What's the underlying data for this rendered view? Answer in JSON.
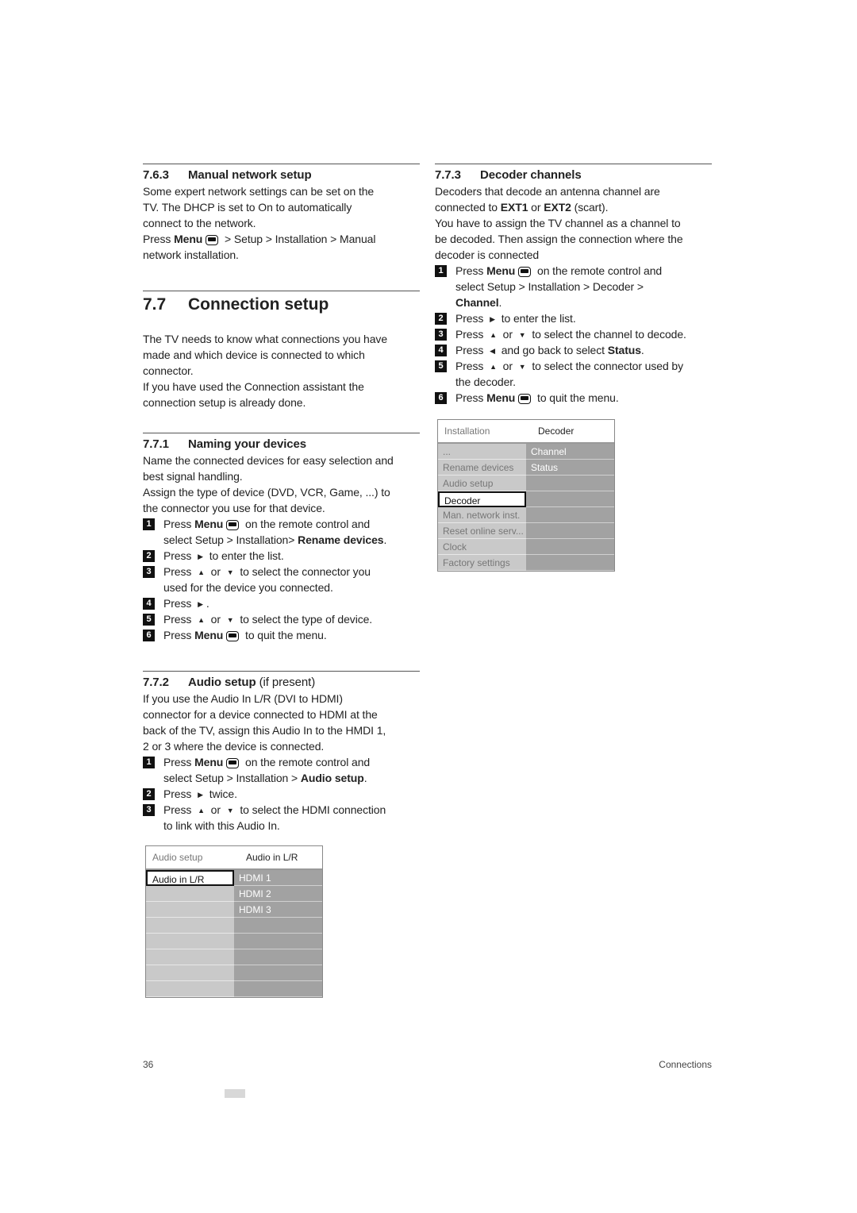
{
  "left": [
    {
      "type": "h3",
      "num": "7.6.3",
      "title": "Manual network setup",
      "lines": [
        [
          "Some expert network settings can be set on the"
        ],
        [
          "TV. The DHCP is set to On to automatically"
        ],
        [
          "connect to the network."
        ],
        [
          "Press ",
          {
            "b": "Menu"
          },
          {
            "icon": "menu"
          },
          " > Setup > Installation > Manual"
        ],
        [
          "network installation."
        ]
      ]
    },
    {
      "type": "h2",
      "num": "7.7",
      "title": "Connection setup",
      "lines": [
        [
          "The TV needs to know what connections you have"
        ],
        [
          "made and which device is connected to which"
        ],
        [
          "connector."
        ],
        [
          "If you have used the Connection assistant the"
        ],
        [
          "connection setup is already done."
        ]
      ]
    },
    {
      "type": "h3",
      "num": "7.7.1",
      "title": "Naming your devices",
      "lines": [
        [
          "Name the connected devices for easy selection and"
        ],
        [
          "best signal handling."
        ],
        [
          "Assign the type of device (DVD, VCR, Game, ...) to"
        ],
        [
          "the connector you use for that device."
        ]
      ],
      "steps": [
        {
          "n": "1",
          "lines": [
            [
              "Press ",
              {
                "b": "Menu"
              },
              {
                "icon": "menu"
              },
              " on the remote control and"
            ],
            [
              "select Setup > Installation> ",
              {
                "b": "Rename devices"
              },
              "."
            ]
          ]
        },
        {
          "n": "2",
          "lines": [
            [
              "Press ",
              {
                "icon": "right"
              },
              " to enter the list."
            ]
          ]
        },
        {
          "n": "3",
          "lines": [
            [
              "Press ",
              {
                "icon": "up"
              },
              " or ",
              {
                "icon": "down"
              },
              " to select the connector you"
            ],
            [
              "used for the device you connected."
            ]
          ]
        },
        {
          "n": "4",
          "lines": [
            [
              "Press ",
              {
                "icon": "right"
              },
              "."
            ]
          ]
        },
        {
          "n": "5",
          "lines": [
            [
              "Press ",
              {
                "icon": "up"
              },
              " or ",
              {
                "icon": "down"
              },
              " to select the type of device."
            ]
          ]
        },
        {
          "n": "6",
          "lines": [
            [
              "Press ",
              {
                "b": "Menu"
              },
              {
                "icon": "menu"
              },
              " to quit the menu."
            ]
          ]
        }
      ]
    },
    {
      "type": "h3",
      "num": "7.7.2",
      "title": "Audio setup",
      "suffix": " (if present)",
      "lines": [
        [
          "If you use the Audio In L/R (DVI to HDMI)"
        ],
        [
          "connector for a device connected to HDMI at the"
        ],
        [
          "back of the TV, assign this Audio In to the HMDI 1,"
        ],
        [
          "2 or 3 where the device is connected."
        ]
      ],
      "steps": [
        {
          "n": "1",
          "lines": [
            [
              "Press ",
              {
                "b": "Menu"
              },
              {
                "icon": "menu"
              },
              " on the remote control and"
            ],
            [
              "select Setup > Installation > ",
              {
                "b": "Audio setup"
              },
              "."
            ]
          ]
        },
        {
          "n": "2",
          "lines": [
            [
              "Press ",
              {
                "icon": "right"
              },
              " twice."
            ]
          ]
        },
        {
          "n": "3",
          "lines": [
            [
              "Press ",
              {
                "icon": "up"
              },
              " or ",
              {
                "icon": "down"
              },
              " to select the HDMI connection"
            ],
            [
              "to link with this Audio In."
            ]
          ]
        }
      ]
    }
  ],
  "right": [
    {
      "type": "h3",
      "num": "7.7.3",
      "title": "Decoder channels",
      "lines": [
        [
          "Decoders that decode an antenna channel are"
        ],
        [
          "connected to ",
          {
            "b": "EXT1"
          },
          " or ",
          {
            "b": "EXT2"
          },
          " (scart)."
        ],
        [
          "You have to assign the TV channel as a channel to"
        ],
        [
          "be decoded. Then assign the connection where the"
        ],
        [
          "decoder is connected"
        ]
      ],
      "steps": [
        {
          "n": "1",
          "lines": [
            [
              "Press ",
              {
                "b": "Menu"
              },
              {
                "icon": "menu"
              },
              " on the remote control and"
            ],
            [
              "select Setup > Installation > Decoder >"
            ],
            [
              {
                "b": "Channel"
              },
              "."
            ]
          ]
        },
        {
          "n": "2",
          "lines": [
            [
              "Press ",
              {
                "icon": "right"
              },
              " to enter the list."
            ]
          ]
        },
        {
          "n": "3",
          "lines": [
            [
              "Press ",
              {
                "icon": "up"
              },
              " or ",
              {
                "icon": "down"
              },
              " to select the channel to decode."
            ]
          ]
        },
        {
          "n": "4",
          "lines": [
            [
              "Press ",
              {
                "icon": "left"
              },
              " and go back to select ",
              {
                "b": "Status"
              },
              "."
            ]
          ]
        },
        {
          "n": "5",
          "lines": [
            [
              "Press ",
              {
                "icon": "up"
              },
              " or ",
              {
                "icon": "down"
              },
              " to select the connector used by"
            ],
            [
              "the decoder."
            ]
          ]
        },
        {
          "n": "6",
          "lines": [
            [
              "Press ",
              {
                "b": "Menu"
              },
              {
                "icon": "menu"
              },
              " to quit the menu."
            ]
          ]
        }
      ]
    }
  ],
  "decoder_menu": {
    "header_left": "Installation",
    "header_right": "Decoder",
    "left_items": [
      "...",
      "Rename devices",
      "Audio setup",
      "Decoder",
      "Man. network inst.",
      "Reset online serv...",
      "Clock",
      "Factory settings"
    ],
    "right_items": [
      "Channel",
      "Status",
      "",
      "",
      "",
      "",
      "",
      ""
    ],
    "selected_index": 3
  },
  "audio_menu": {
    "header_left": "Audio setup",
    "header_right": "Audio in L/R",
    "left_items": [
      "Audio in L/R",
      "",
      "",
      "",
      "",
      "",
      "",
      ""
    ],
    "right_items": [
      "HDMI 1",
      "HDMI 2",
      "HDMI 3",
      "",
      "",
      "",
      "",
      ""
    ],
    "selected_index": 0
  },
  "footer": {
    "page_number": "36",
    "section": "Connections"
  }
}
